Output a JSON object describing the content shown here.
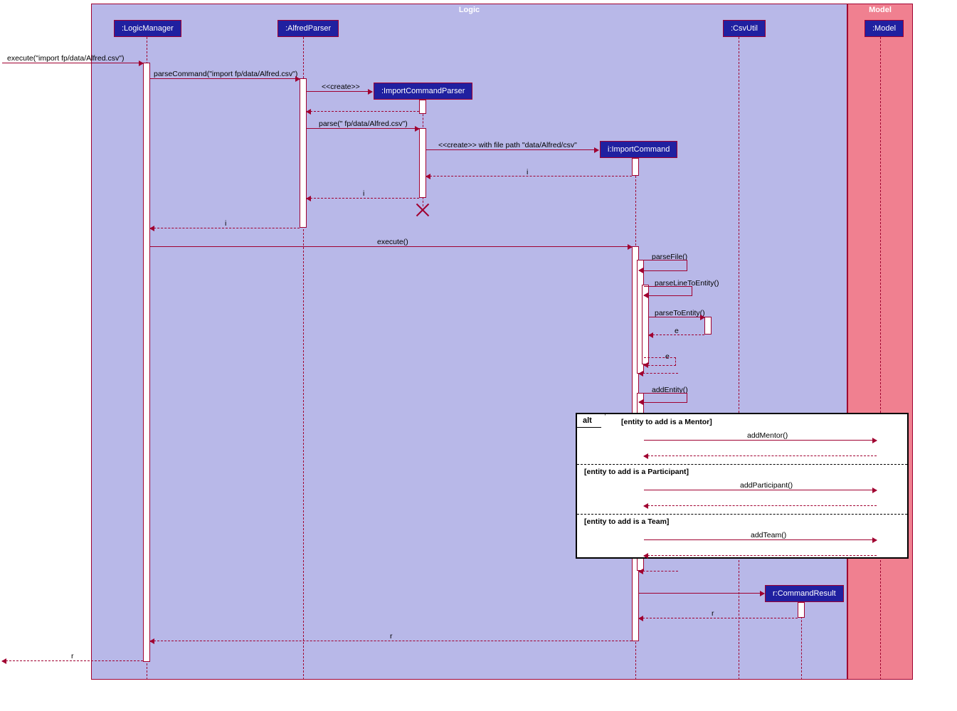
{
  "frames": {
    "logic": "Logic",
    "model": "Model"
  },
  "participants": {
    "logic_manager": ":LogicManager",
    "alfred_parser": ":AlfredParser",
    "import_command_parser": ":ImportCommandParser",
    "import_command": "i:ImportCommand",
    "csv_util": ":CsvUtil",
    "command_result": "r:CommandResult",
    "model": ":Model"
  },
  "messages": {
    "execute_import": "execute(\"import fp/data/Alfred.csv\")",
    "parse_command": "parseCommand(\"import fp/data/Alfred.csv\")",
    "create1": "<<create>>",
    "parse": "parse(\" fp/data/Alfred.csv\")",
    "create_with_path": "<<create>> with file path \"data/Alfred/csv\"",
    "return_i1": "i",
    "return_i2": "i",
    "return_i3": "i",
    "execute": "execute()",
    "parse_file": "parseFile()",
    "parse_line": "parseLineToEntity()",
    "parse_to_entity": "parseToEntity()",
    "return_e1": "e",
    "return_e2": "e",
    "add_entity": "addEntity()",
    "add_mentor": "addMentor()",
    "add_participant": "addParticipant()",
    "add_team": "addTeam()",
    "return_r1": "r",
    "return_r2": "r",
    "return_r3": "r"
  },
  "alt": {
    "label": "alt",
    "guard1": "[entity to add is a Mentor]",
    "guard2": "[entity to add is a Participant]",
    "guard3": "[entity to add is a Team]"
  }
}
